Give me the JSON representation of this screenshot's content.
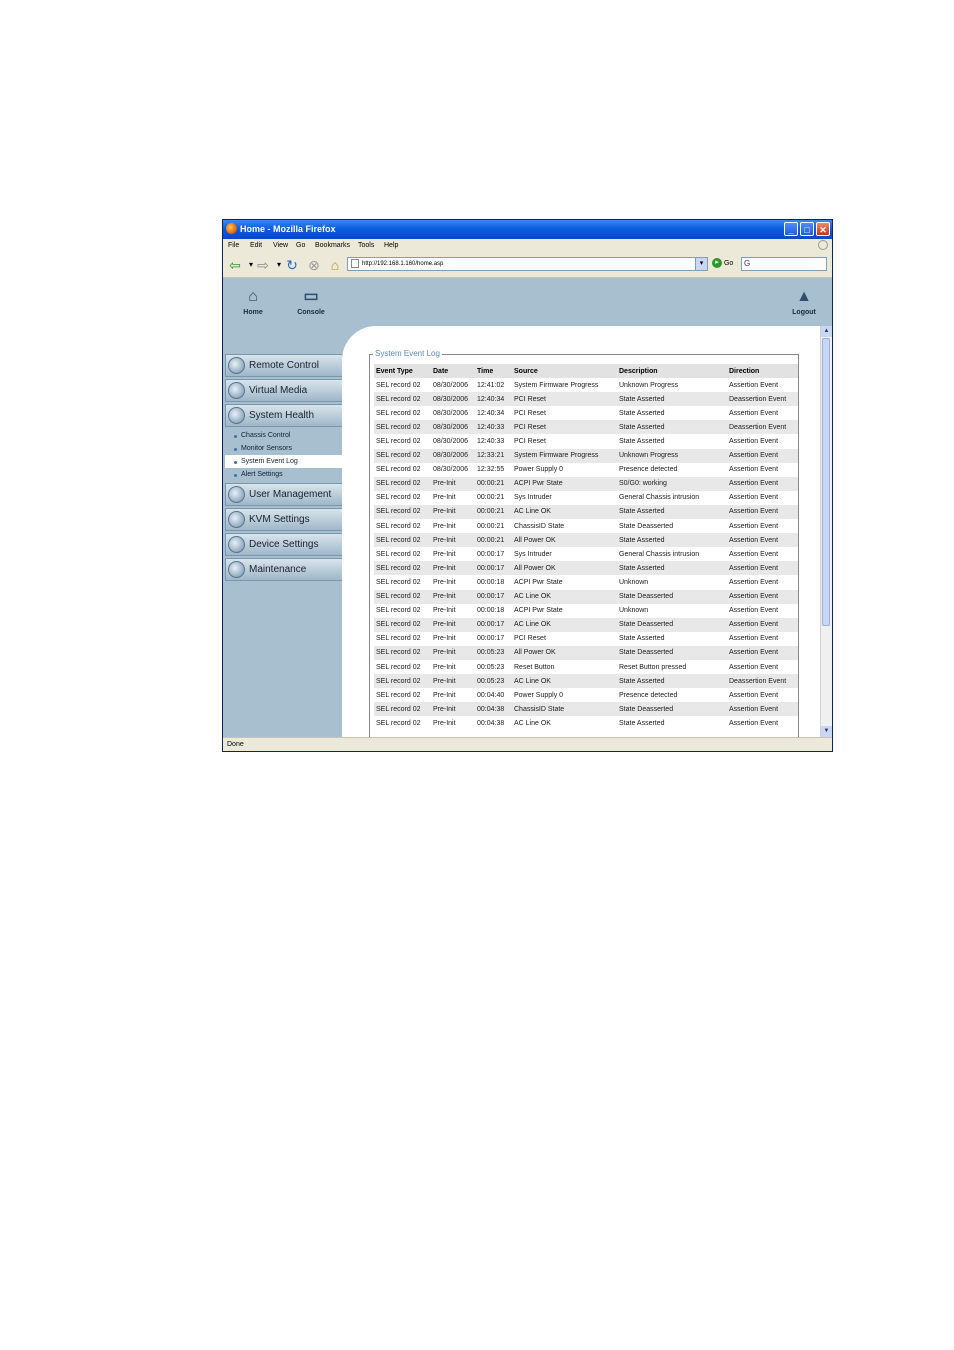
{
  "window": {
    "title": "Home - Mozilla Firefox"
  },
  "menu": [
    "File",
    "Edit",
    "View",
    "Go",
    "Bookmarks",
    "Tools",
    "Help"
  ],
  "nav": {
    "url": "http://192.168.1.160/home.asp",
    "go_label": "Go",
    "search_glyph": "G"
  },
  "toolbar": {
    "home_label": "Home",
    "console_label": "Console",
    "logout_label": "Logout"
  },
  "sidebar": {
    "remote_control": "Remote Control",
    "virtual_media": "Virtual Media",
    "system_health": "System Health",
    "sub": [
      "Chassis Control",
      "Monitor Sensors",
      "System Event Log",
      "Alert Settings"
    ],
    "user_management": "User Management",
    "kvm_settings": "KVM Settings",
    "device_settings": "Device Settings",
    "maintenance": "Maintenance"
  },
  "panel": {
    "legend": "System Event Log"
  },
  "table": {
    "headers": [
      "Event Type",
      "Date",
      "Time",
      "Source",
      "Description",
      "Direction"
    ],
    "rows": [
      [
        "SEL record 02",
        "08/30/2006",
        "12:41:02",
        "System Firmware Progress",
        "Unknown Progress",
        "Assertion Event"
      ],
      [
        "SEL record 02",
        "08/30/2006",
        "12:40:34",
        "PCI Reset",
        "State Asserted",
        "Deassertion Event"
      ],
      [
        "SEL record 02",
        "08/30/2006",
        "12:40:34",
        "PCI Reset",
        "State Asserted",
        "Assertion Event"
      ],
      [
        "SEL record 02",
        "08/30/2006",
        "12:40:33",
        "PCI Reset",
        "State Asserted",
        "Deassertion Event"
      ],
      [
        "SEL record 02",
        "08/30/2006",
        "12:40:33",
        "PCI Reset",
        "State Asserted",
        "Assertion Event"
      ],
      [
        "SEL record 02",
        "08/30/2006",
        "12:33:21",
        "System Firmware Progress",
        "Unknown Progress",
        "Assertion Event"
      ],
      [
        "SEL record 02",
        "08/30/2006",
        "12:32:55",
        "Power Supply 0",
        "Presence detected",
        "Assertion Event"
      ],
      [
        "SEL record 02",
        "Pre-Init",
        "00:00:21",
        "ACPI Pwr State",
        "S0/G0: working",
        "Assertion Event"
      ],
      [
        "SEL record 02",
        "Pre-Init",
        "00:00:21",
        "Sys Intruder",
        "General Chassis intrusion",
        "Assertion Event"
      ],
      [
        "SEL record 02",
        "Pre-Init",
        "00:00:21",
        "AC Line OK",
        "State Asserted",
        "Assertion Event"
      ],
      [
        "SEL record 02",
        "Pre-Init",
        "00:00:21",
        "ChassisID State",
        "State Deasserted",
        "Assertion Event"
      ],
      [
        "SEL record 02",
        "Pre-Init",
        "00:00:21",
        "All Power OK",
        "State Asserted",
        "Assertion Event"
      ],
      [
        "SEL record 02",
        "Pre-Init",
        "00:00:17",
        "Sys Intruder",
        "General Chassis intrusion",
        "Assertion Event"
      ],
      [
        "SEL record 02",
        "Pre-Init",
        "00:00:17",
        "All Power OK",
        "State Asserted",
        "Assertion Event"
      ],
      [
        "SEL record 02",
        "Pre-Init",
        "00:00:18",
        "ACPI Pwr State",
        "Unknown",
        "Assertion Event"
      ],
      [
        "SEL record 02",
        "Pre-Init",
        "00:00:17",
        "AC Line OK",
        "State Deasserted",
        "Assertion Event"
      ],
      [
        "SEL record 02",
        "Pre-Init",
        "00:00:18",
        "ACPI Pwr State",
        "Unknown",
        "Assertion Event"
      ],
      [
        "SEL record 02",
        "Pre-Init",
        "00:00:17",
        "AC Line OK",
        "State Deasserted",
        "Assertion Event"
      ],
      [
        "SEL record 02",
        "Pre-Init",
        "00:00:17",
        "PCI Reset",
        "State Asserted",
        "Assertion Event"
      ],
      [
        "SEL record 02",
        "Pre-Init",
        "00:05:23",
        "All Power OK",
        "State Deasserted",
        "Assertion Event"
      ],
      [
        "SEL record 02",
        "Pre-Init",
        "00:05:23",
        "Reset Button",
        "Reset Button pressed",
        "Assertion Event"
      ],
      [
        "SEL record 02",
        "Pre-Init",
        "00:05:23",
        "AC Line OK",
        "State Asserted",
        "Deassertion Event"
      ],
      [
        "SEL record 02",
        "Pre-Init",
        "00:04:40",
        "Power Supply 0",
        "Presence detected",
        "Assertion Event"
      ],
      [
        "SEL record 02",
        "Pre-Init",
        "00:04:38",
        "ChassisID State",
        "State Deasserted",
        "Assertion Event"
      ],
      [
        "SEL record 02",
        "Pre-Init",
        "00:04:38",
        "AC Line OK",
        "State Asserted",
        "Assertion Event"
      ]
    ]
  },
  "status": {
    "text": "Done"
  }
}
